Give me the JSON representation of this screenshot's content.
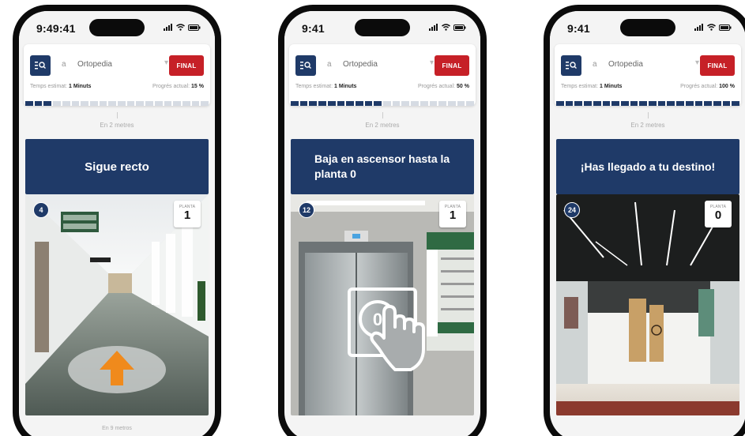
{
  "common": {
    "search_prefix": "a",
    "destination": "Ortopedia",
    "final_label": "FINAL",
    "distance_top": "En 2 metres",
    "est_label": "Temps estimat:",
    "est_value": "1 Minuts",
    "progress_label": "Progrés actual:",
    "floor_label": "PLANTA"
  },
  "phones": [
    {
      "time": "9:49:41",
      "progress_value": "15 %",
      "progress_fraction": 0.15,
      "instruction": "Sigue recto",
      "step": "4",
      "floor": "1",
      "distance_bottom": "En 9 metros",
      "scene": "corridor"
    },
    {
      "time": "9:41",
      "progress_value": "50 %",
      "progress_fraction": 0.5,
      "instruction": "Baja en ascensor hasta la planta 0",
      "step": "12",
      "floor": "1",
      "scene": "elevator"
    },
    {
      "time": "9:41",
      "progress_value": "100 %",
      "progress_fraction": 1.0,
      "instruction": "¡Has llegado a tu destino!",
      "step": "24",
      "floor": "0",
      "scene": "destination"
    }
  ],
  "colors": {
    "brand_navy": "#1f3a68",
    "final_red": "#c62027",
    "arrow_orange": "#f08a1c"
  }
}
